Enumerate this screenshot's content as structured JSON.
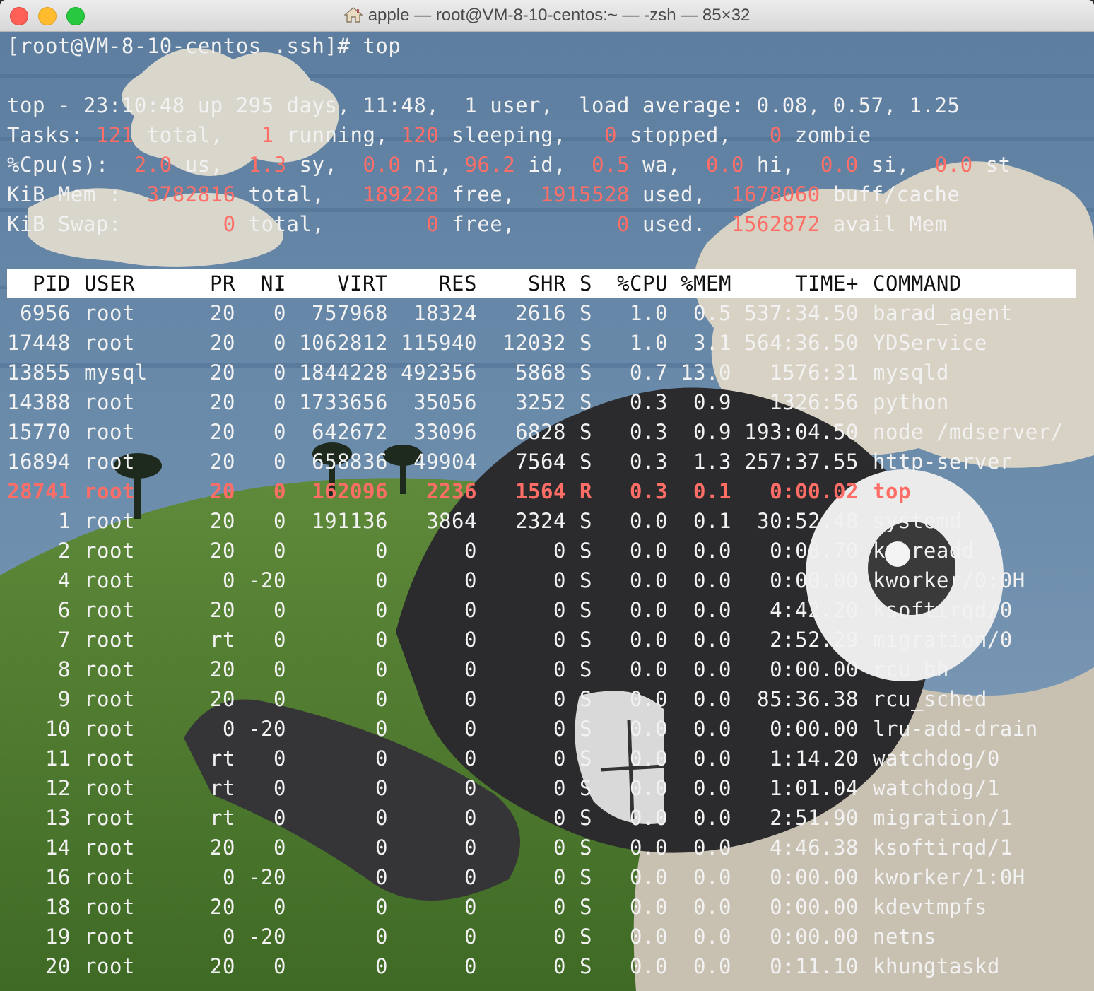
{
  "window": {
    "title": "apple — root@VM-8-10-centos:~ — -zsh — 85×32",
    "colors": {
      "highlight": "#ff6e66",
      "header_bg": "#ffffff",
      "text": "#f2f2f2"
    }
  },
  "prompt": {
    "text": "[root@VM-8-10-centos .ssh]# top"
  },
  "summary": {
    "top": {
      "a": "top - 23:10:48 up 295 days, 11:48,  1 user,  load average: 0.08, 0.57, 1.25"
    },
    "tasks": {
      "label": "Tasks: ",
      "total": "121",
      "total_l": " total,   ",
      "running": "1",
      "running_l": " running, ",
      "sleeping": "120",
      "sleeping_l": " sleeping,   ",
      "stopped": "0",
      "stopped_l": " stopped,   ",
      "zombie": "0",
      "zombie_l": " zombie"
    },
    "cpu": {
      "label": "%Cpu(s):  ",
      "us": "2.0",
      "us_l": " us,  ",
      "sy": "1.3",
      "sy_l": " sy,  ",
      "ni": "0.0",
      "ni_l": " ni, ",
      "id": "96.2",
      "id_l": " id,  ",
      "wa": "0.5",
      "wa_l": " wa,  ",
      "hi": "0.0",
      "hi_l": " hi,  ",
      "si": "0.0",
      "si_l": " si,  ",
      "st": "0.0",
      "st_l": " st"
    },
    "mem": {
      "label": "KiB Mem :  ",
      "total": "3782816",
      "total_l": " total,   ",
      "free": "189228",
      "free_l": " free,  ",
      "used": "1915528",
      "used_l": " used,  ",
      "buff": "1678060",
      "buff_l": " buff/cache"
    },
    "swap": {
      "label": "KiB Swap:        ",
      "total": "0",
      "total_l": " total,        ",
      "free": "0",
      "free_l": " free,        ",
      "used": "0",
      "used_l": " used.  ",
      "avail": "1562872",
      "avail_l": " avail Mem"
    }
  },
  "table": {
    "columns": [
      "PID",
      "USER",
      "PR",
      "NI",
      "VIRT",
      "RES",
      "SHR",
      "S",
      "%CPU",
      "%MEM",
      "TIME+",
      "COMMAND"
    ],
    "rows": [
      [
        "6956",
        "root",
        "20",
        "0",
        "757968",
        "18324",
        "2616",
        "S",
        "1.0",
        "0.5",
        "537:34.50",
        "barad_agent"
      ],
      [
        "17448",
        "root",
        "20",
        "0",
        "1062812",
        "115940",
        "12032",
        "S",
        "1.0",
        "3.1",
        "564:36.50",
        "YDService"
      ],
      [
        "13855",
        "mysql",
        "20",
        "0",
        "1844228",
        "492356",
        "5868",
        "S",
        "0.7",
        "13.0",
        "1576:31",
        "mysqld"
      ],
      [
        "14388",
        "root",
        "20",
        "0",
        "1733656",
        "35056",
        "3252",
        "S",
        "0.3",
        "0.9",
        "1326:56",
        "python"
      ],
      [
        "15770",
        "root",
        "20",
        "0",
        "642672",
        "33096",
        "6828",
        "S",
        "0.3",
        "0.9",
        "193:04.50",
        "node /mdserver/"
      ],
      [
        "16894",
        "root",
        "20",
        "0",
        "658836",
        "49904",
        "7564",
        "S",
        "0.3",
        "1.3",
        "257:37.55",
        "http-server"
      ],
      [
        "28741",
        "root",
        "20",
        "0",
        "162096",
        "2236",
        "1564",
        "R",
        "0.3",
        "0.1",
        "0:00.02",
        "top"
      ],
      [
        "1",
        "root",
        "20",
        "0",
        "191136",
        "3864",
        "2324",
        "S",
        "0.0",
        "0.1",
        "30:52.48",
        "systemd"
      ],
      [
        "2",
        "root",
        "20",
        "0",
        "0",
        "0",
        "0",
        "S",
        "0.0",
        "0.0",
        "0:08.70",
        "kthreadd"
      ],
      [
        "4",
        "root",
        "0",
        "-20",
        "0",
        "0",
        "0",
        "S",
        "0.0",
        "0.0",
        "0:00.00",
        "kworker/0:0H"
      ],
      [
        "6",
        "root",
        "20",
        "0",
        "0",
        "0",
        "0",
        "S",
        "0.0",
        "0.0",
        "4:42.20",
        "ksoftirqd/0"
      ],
      [
        "7",
        "root",
        "rt",
        "0",
        "0",
        "0",
        "0",
        "S",
        "0.0",
        "0.0",
        "2:52.29",
        "migration/0"
      ],
      [
        "8",
        "root",
        "20",
        "0",
        "0",
        "0",
        "0",
        "S",
        "0.0",
        "0.0",
        "0:00.00",
        "rcu_bh"
      ],
      [
        "9",
        "root",
        "20",
        "0",
        "0",
        "0",
        "0",
        "S",
        "0.0",
        "0.0",
        "85:36.38",
        "rcu_sched"
      ],
      [
        "10",
        "root",
        "0",
        "-20",
        "0",
        "0",
        "0",
        "S",
        "0.0",
        "0.0",
        "0:00.00",
        "lru-add-drain"
      ],
      [
        "11",
        "root",
        "rt",
        "0",
        "0",
        "0",
        "0",
        "S",
        "0.0",
        "0.0",
        "1:14.20",
        "watchdog/0"
      ],
      [
        "12",
        "root",
        "rt",
        "0",
        "0",
        "0",
        "0",
        "S",
        "0.0",
        "0.0",
        "1:01.04",
        "watchdog/1"
      ],
      [
        "13",
        "root",
        "rt",
        "0",
        "0",
        "0",
        "0",
        "S",
        "0.0",
        "0.0",
        "2:51.90",
        "migration/1"
      ],
      [
        "14",
        "root",
        "20",
        "0",
        "0",
        "0",
        "0",
        "S",
        "0.0",
        "0.0",
        "4:46.38",
        "ksoftirqd/1"
      ],
      [
        "16",
        "root",
        "0",
        "-20",
        "0",
        "0",
        "0",
        "S",
        "0.0",
        "0.0",
        "0:00.00",
        "kworker/1:0H"
      ],
      [
        "18",
        "root",
        "20",
        "0",
        "0",
        "0",
        "0",
        "S",
        "0.0",
        "0.0",
        "0:00.00",
        "kdevtmpfs"
      ],
      [
        "19",
        "root",
        "0",
        "-20",
        "0",
        "0",
        "0",
        "S",
        "0.0",
        "0.0",
        "0:00.00",
        "netns"
      ],
      [
        "20",
        "root",
        "20",
        "0",
        "0",
        "0",
        "0",
        "S",
        "0.0",
        "0.0",
        "0:11.10",
        "khungtaskd"
      ]
    ]
  }
}
